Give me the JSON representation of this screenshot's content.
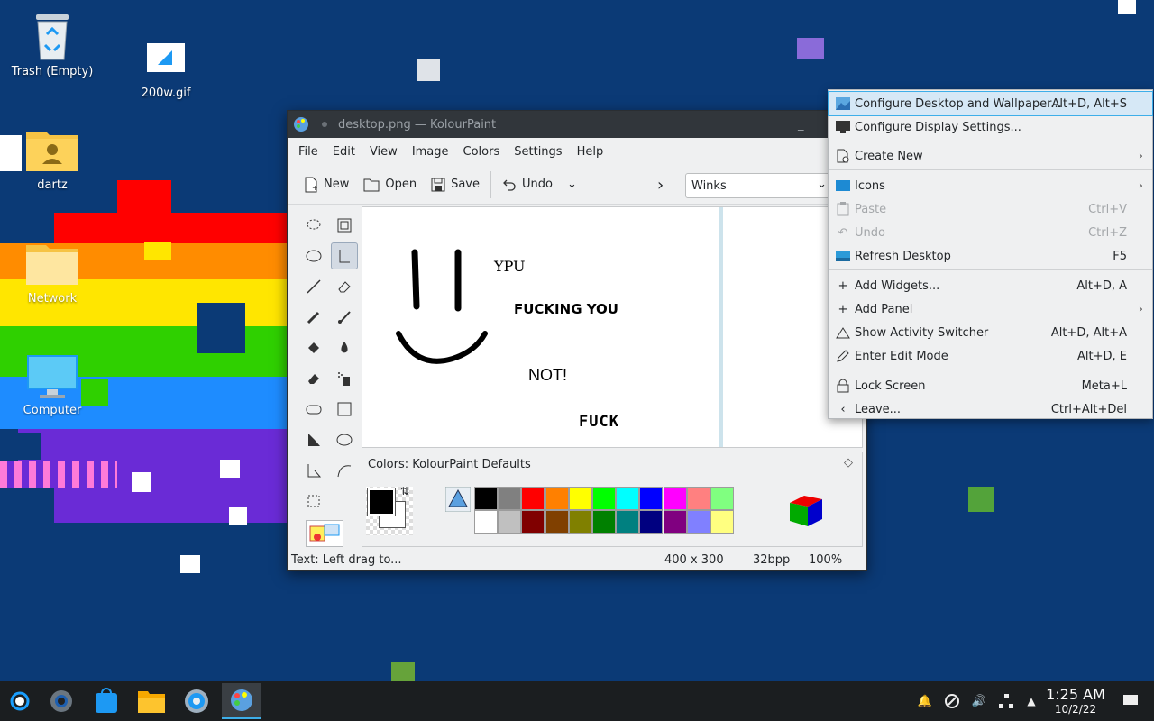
{
  "desktop": {
    "icons": [
      {
        "label": "Trash (Empty)",
        "icon": "trash-icon"
      },
      {
        "label": "200w.gif",
        "icon": "image-file-icon"
      },
      {
        "label": "dartz",
        "icon": "home-folder-icon"
      },
      {
        "label": "Network",
        "icon": "network-folder-icon"
      },
      {
        "label": "Computer",
        "icon": "computer-icon"
      }
    ]
  },
  "kolourpaint": {
    "title": "desktop.png — KolourPaint",
    "menu": [
      "File",
      "Edit",
      "View",
      "Image",
      "Colors",
      "Settings",
      "Help"
    ],
    "toolbar": {
      "new": "New",
      "open": "Open",
      "save": "Save",
      "undo": "Undo",
      "font": "Winks"
    },
    "canvas_text": {
      "t1": "YPU",
      "t2": "FUCKING YOU",
      "t3": "NOT!",
      "t4": "FUCK"
    },
    "colors_title": "Colors: KolourPaint Defaults",
    "palette_top": [
      "#000000",
      "#808080",
      "#ff0000",
      "#ff8000",
      "#ffff00",
      "#00ff00",
      "#00ffff",
      "#0000ff",
      "#ff00ff",
      "#ff8080",
      "#80ff80"
    ],
    "palette_bottom": [
      "#ffffff",
      "#c0c0c0",
      "#800000",
      "#804000",
      "#808000",
      "#008000",
      "#008080",
      "#000080",
      "#800080",
      "#8080ff",
      "#ffff80"
    ],
    "status": {
      "message": "Text: Left drag to...",
      "size": "400 x 300",
      "depth": "32bpp",
      "zoom": "100%"
    }
  },
  "context_menu": {
    "items": [
      {
        "label": "Configure Desktop and Wallpaper...",
        "shortcut": "Alt+D, Alt+S"
      },
      {
        "label": "Configure Display Settings...",
        "shortcut": ""
      },
      {
        "label": "Create New",
        "shortcut": ""
      },
      {
        "label": "Icons",
        "shortcut": ""
      },
      {
        "label": "Paste",
        "shortcut": "Ctrl+V"
      },
      {
        "label": "Undo",
        "shortcut": "Ctrl+Z"
      },
      {
        "label": "Refresh Desktop",
        "shortcut": "F5"
      },
      {
        "label": "Add Widgets...",
        "shortcut": "Alt+D, A"
      },
      {
        "label": "Add Panel",
        "shortcut": ""
      },
      {
        "label": "Show Activity Switcher",
        "shortcut": "Alt+D, Alt+A"
      },
      {
        "label": "Enter Edit Mode",
        "shortcut": "Alt+D, E"
      },
      {
        "label": "Lock Screen",
        "shortcut": "Meta+L"
      },
      {
        "label": "Leave...",
        "shortcut": "Ctrl+Alt+Del"
      }
    ]
  },
  "panel": {
    "time": "1:25 AM",
    "date": "10/2/22"
  }
}
